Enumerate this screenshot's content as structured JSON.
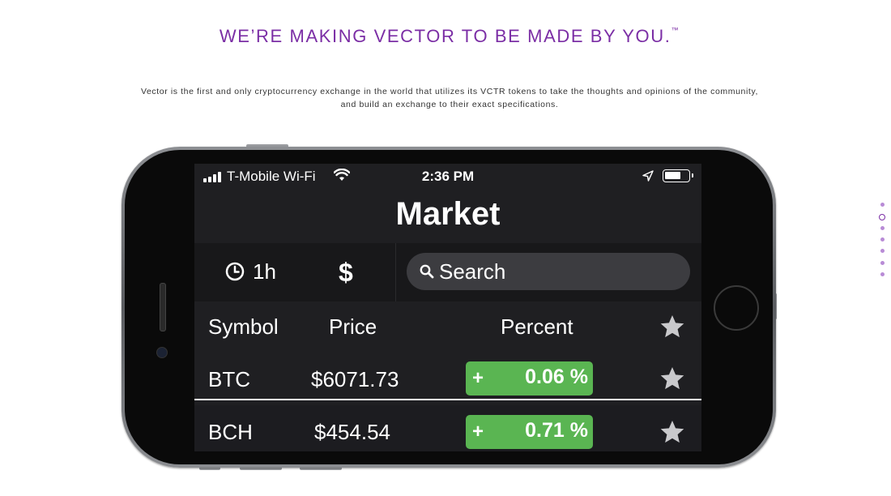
{
  "hero": {
    "headline": "WE’RE MAKING VECTOR TO BE MADE BY YOU.",
    "trademark": "™",
    "description_line1": "Vector is the first and only cryptocurrency exchange in the world that utilizes its VCTR tokens to take the thoughts and opinions of the community,",
    "description_line2": "and build an exchange to their exact specifications."
  },
  "phone": {
    "status_bar": {
      "carrier": "T-Mobile Wi-Fi",
      "time": "2:36 PM",
      "battery_level": 0.7
    },
    "screen_title": "Market",
    "toolbar": {
      "timeframe_label": "1h",
      "currency_symbol": "$",
      "search_placeholder": "Search"
    },
    "table": {
      "headers": {
        "symbol": "Symbol",
        "price": "Price",
        "percent": "Percent"
      },
      "rows": [
        {
          "symbol": "BTC",
          "price": "$6071.73",
          "sign": "+",
          "percent": "0.06 %"
        },
        {
          "symbol": "BCH",
          "price": "$454.54",
          "sign": "+",
          "percent": "0.71 %"
        }
      ]
    }
  },
  "pagination": {
    "total": 7,
    "active_index": 1
  },
  "colors": {
    "brand_purple": "#7b2ea5",
    "positive_green": "#5ab552",
    "screen_background": "#1f1f22"
  }
}
